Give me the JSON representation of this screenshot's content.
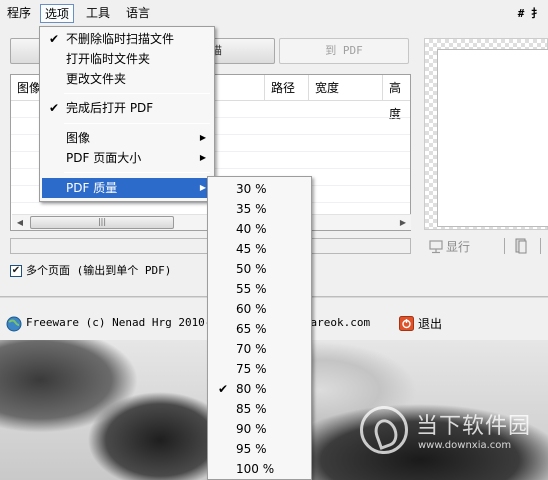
{
  "menubar": {
    "items": [
      "程序",
      "选项",
      "工具",
      "语言"
    ],
    "right_label": "# 扌"
  },
  "toolbar": {
    "scan_label": "描",
    "to_pdf_label": "到 PDF"
  },
  "list": {
    "columns": [
      "图像",
      "路径",
      "宽度",
      "高度"
    ]
  },
  "options": {
    "multi_page_checked": true,
    "multi_page_label": "多个页面 (输出到单个 PDF)"
  },
  "preview": {
    "show_label": "显行"
  },
  "status": {
    "freeware_text": "Freeware (c) Nenad Hrg 2010-20",
    "site_fragment": "oftwareok.com",
    "exit_label": "退出"
  },
  "options_menu": {
    "items": [
      {
        "label": "不删除临时扫描文件",
        "checked": true
      },
      {
        "label": "打开临时文件夹",
        "checked": false
      },
      {
        "label": "更改文件夹",
        "checked": false
      },
      {
        "label": "完成后打开 PDF",
        "checked": true
      },
      {
        "label": "图像",
        "submenu": true
      },
      {
        "label": "PDF 页面大小",
        "submenu": true
      },
      {
        "label": "PDF 质量",
        "submenu": true,
        "highlighted": true
      }
    ]
  },
  "quality_menu": {
    "items": [
      "30 %",
      "35 %",
      "40 %",
      "45 %",
      "50 %",
      "55 %",
      "60 %",
      "65 %",
      "70 %",
      "75 %",
      "80 %",
      "85 %",
      "90 %",
      "95 %",
      "100 %"
    ],
    "selected": "80 %"
  },
  "watermark": {
    "title": "当下软件园",
    "url": "www.downxia.com"
  }
}
